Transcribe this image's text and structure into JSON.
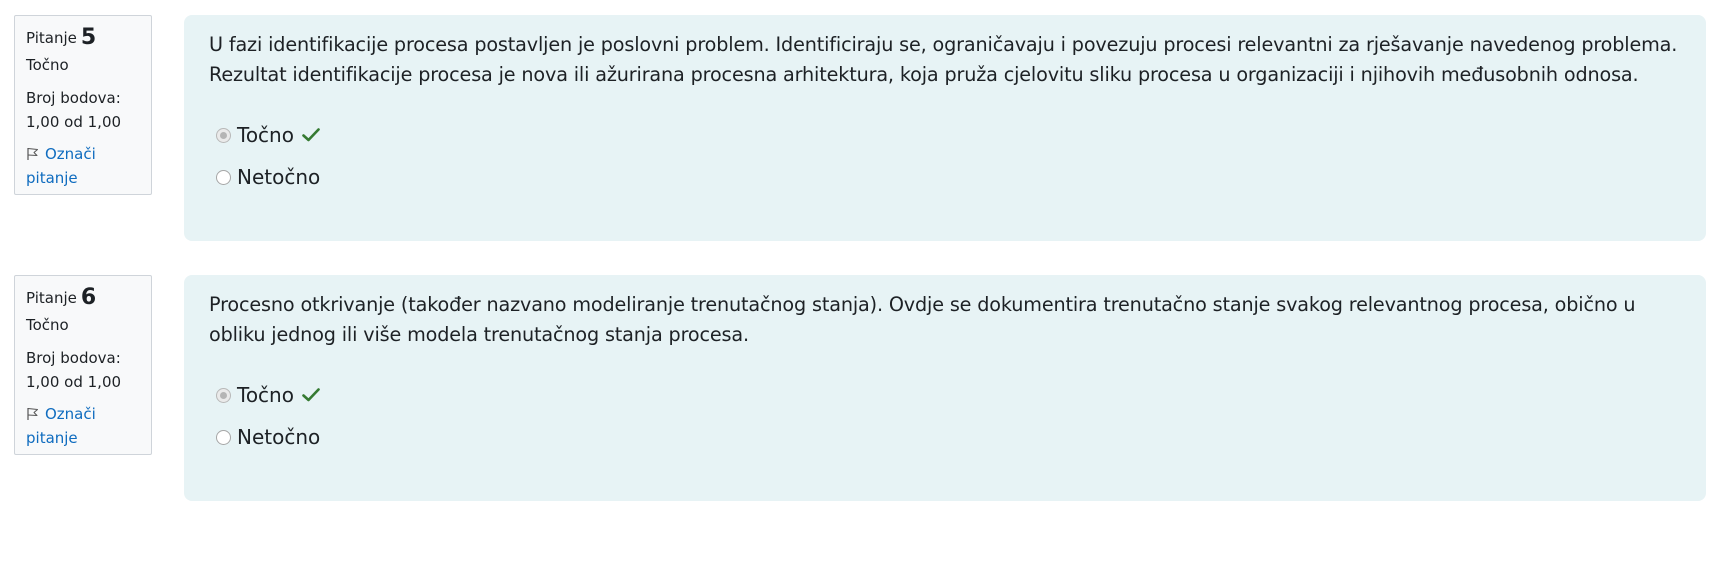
{
  "questions": [
    {
      "label": "Pitanje",
      "number": "5",
      "state": "Točno",
      "grade_label": "Broj bodova:",
      "grade_value": "1,00 od 1,00",
      "flag_text": "Označi pitanje",
      "text": "U fazi identifikacije procesa postavljen je poslovni problem. Identificiraju se, ograničavaju i povezuju procesi relevantni za rješavanje navedenog problema. Rezultat identifikacije procesa je nova ili ažurirana procesna arhitektura, koja pruža cjelovitu sliku procesa u organizaciji i njihovih međusobnih odnosa.",
      "answers": [
        {
          "label": "Točno",
          "checked": true,
          "correct": true
        },
        {
          "label": "Netočno",
          "checked": false,
          "correct": false
        }
      ]
    },
    {
      "label": "Pitanje",
      "number": "6",
      "state": "Točno",
      "grade_label": "Broj bodova:",
      "grade_value": "1,00 od 1,00",
      "flag_text": "Označi pitanje",
      "text": "Procesno otkrivanje (također nazvano modeliranje trenutačnog stanja). Ovdje se dokumentira trenutačno stanje svakog relevantnog procesa, obično u obliku jednog ili više modela trenutačnog stanja procesa.",
      "answers": [
        {
          "label": "Točno",
          "checked": true,
          "correct": true
        },
        {
          "label": "Netočno",
          "checked": false,
          "correct": false
        }
      ]
    }
  ],
  "colors": {
    "info_bg": "#f8f9fa",
    "content_bg": "#e7f3f5",
    "link": "#0f6cbf",
    "correct_check": "#357a32"
  },
  "icons": {
    "flag": "flag-icon",
    "correct": "check-icon"
  }
}
